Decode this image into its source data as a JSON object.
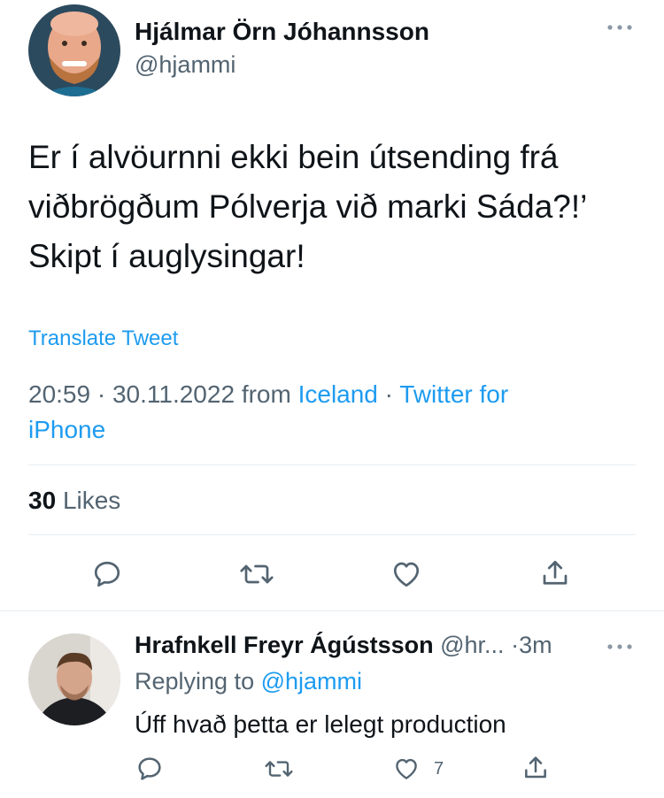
{
  "tweet": {
    "author_name": "Hjálmar Örn Jóhannsson",
    "author_handle": "@hjammi",
    "text": "Er í alvöurnni ekki bein útsending frá viðbrögðum Pólverja við marki Sáda?!’ Skipt í auglysingar!",
    "translate_label": "Translate Tweet",
    "time": "20:59",
    "date": "30.11.2022",
    "from_label": "from",
    "location": "Iceland",
    "separator": "·",
    "client_line1": "Twitter for",
    "client_line2": "iPhone",
    "likes_count": "30",
    "likes_label": "Likes"
  },
  "actions": {
    "icons": [
      "reply-icon",
      "retweet-icon",
      "like-icon",
      "share-icon"
    ]
  },
  "reply": {
    "author_name": "Hrafnkell Freyr Ágústsson",
    "author_handle": "@hr...",
    "time": "3m",
    "separator": "·",
    "replying_prefix": "Replying to",
    "replying_to": "@hjammi",
    "text": "Úff hvað þetta er lelegt production",
    "like_count": "7"
  },
  "colors": {
    "accent": "#1d9bf0",
    "secondary_text": "#536471",
    "divider": "#e6ecf0"
  }
}
